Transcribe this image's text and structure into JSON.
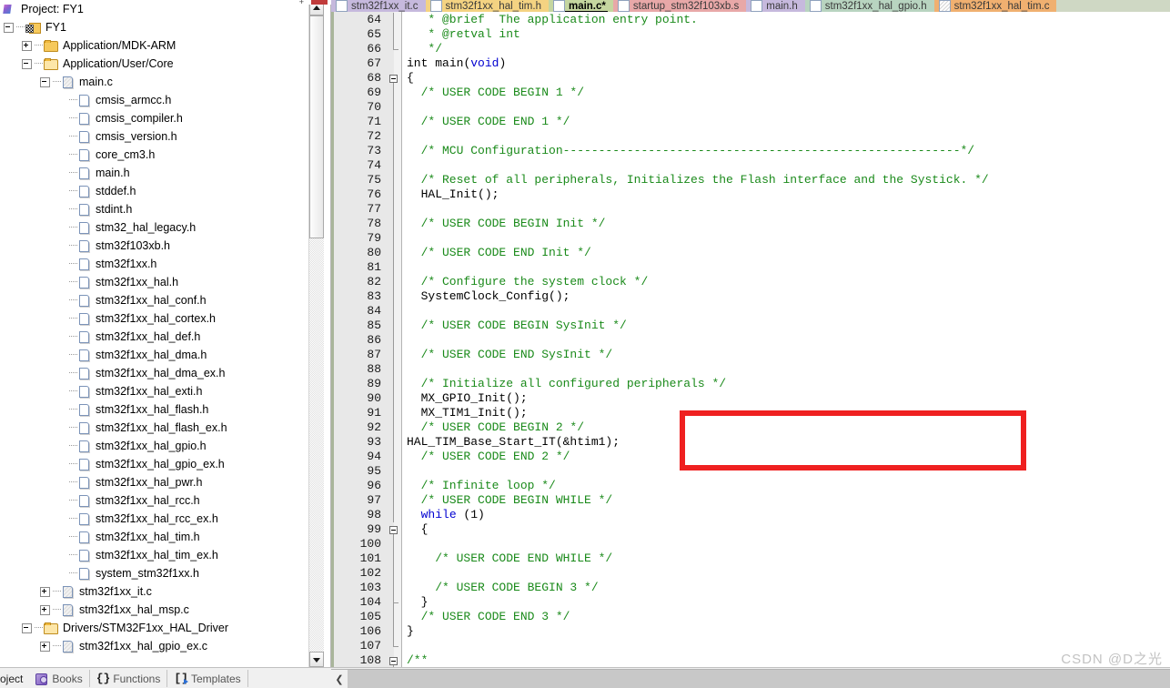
{
  "app": {
    "ide": "Keil uVision",
    "watermark": "CSDN @D之光"
  },
  "project_pane": {
    "header": "Project: FY1",
    "tree": [
      {
        "depth": 0,
        "label": "FY1",
        "icon": "target-icon",
        "expander": "minus"
      },
      {
        "depth": 1,
        "label": "Application/MDK-ARM",
        "icon": "folder-icon",
        "expander": "plus"
      },
      {
        "depth": 1,
        "label": "Application/User/Core",
        "icon": "folder-open-icon",
        "expander": "minus"
      },
      {
        "depth": 2,
        "label": "main.c",
        "icon": "source-file-icon",
        "expander": "minus"
      },
      {
        "depth": 3,
        "label": "cmsis_armcc.h",
        "icon": "header-file-icon",
        "expander": "none"
      },
      {
        "depth": 3,
        "label": "cmsis_compiler.h",
        "icon": "header-file-icon",
        "expander": "none"
      },
      {
        "depth": 3,
        "label": "cmsis_version.h",
        "icon": "header-file-icon",
        "expander": "none"
      },
      {
        "depth": 3,
        "label": "core_cm3.h",
        "icon": "header-file-icon",
        "expander": "none"
      },
      {
        "depth": 3,
        "label": "main.h",
        "icon": "header-file-icon",
        "expander": "none"
      },
      {
        "depth": 3,
        "label": "stddef.h",
        "icon": "header-file-icon",
        "expander": "none"
      },
      {
        "depth": 3,
        "label": "stdint.h",
        "icon": "header-file-icon",
        "expander": "none"
      },
      {
        "depth": 3,
        "label": "stm32_hal_legacy.h",
        "icon": "header-file-icon",
        "expander": "none"
      },
      {
        "depth": 3,
        "label": "stm32f103xb.h",
        "icon": "header-file-icon",
        "expander": "none"
      },
      {
        "depth": 3,
        "label": "stm32f1xx.h",
        "icon": "header-file-icon",
        "expander": "none"
      },
      {
        "depth": 3,
        "label": "stm32f1xx_hal.h",
        "icon": "header-file-icon",
        "expander": "none"
      },
      {
        "depth": 3,
        "label": "stm32f1xx_hal_conf.h",
        "icon": "header-file-icon",
        "expander": "none"
      },
      {
        "depth": 3,
        "label": "stm32f1xx_hal_cortex.h",
        "icon": "header-file-icon",
        "expander": "none"
      },
      {
        "depth": 3,
        "label": "stm32f1xx_hal_def.h",
        "icon": "header-file-icon",
        "expander": "none"
      },
      {
        "depth": 3,
        "label": "stm32f1xx_hal_dma.h",
        "icon": "header-file-icon",
        "expander": "none"
      },
      {
        "depth": 3,
        "label": "stm32f1xx_hal_dma_ex.h",
        "icon": "header-file-icon",
        "expander": "none"
      },
      {
        "depth": 3,
        "label": "stm32f1xx_hal_exti.h",
        "icon": "header-file-icon",
        "expander": "none"
      },
      {
        "depth": 3,
        "label": "stm32f1xx_hal_flash.h",
        "icon": "header-file-icon",
        "expander": "none"
      },
      {
        "depth": 3,
        "label": "stm32f1xx_hal_flash_ex.h",
        "icon": "header-file-icon",
        "expander": "none"
      },
      {
        "depth": 3,
        "label": "stm32f1xx_hal_gpio.h",
        "icon": "header-file-icon",
        "expander": "none"
      },
      {
        "depth": 3,
        "label": "stm32f1xx_hal_gpio_ex.h",
        "icon": "header-file-icon",
        "expander": "none"
      },
      {
        "depth": 3,
        "label": "stm32f1xx_hal_pwr.h",
        "icon": "header-file-icon",
        "expander": "none"
      },
      {
        "depth": 3,
        "label": "stm32f1xx_hal_rcc.h",
        "icon": "header-file-icon",
        "expander": "none"
      },
      {
        "depth": 3,
        "label": "stm32f1xx_hal_rcc_ex.h",
        "icon": "header-file-icon",
        "expander": "none"
      },
      {
        "depth": 3,
        "label": "stm32f1xx_hal_tim.h",
        "icon": "header-file-icon",
        "expander": "none"
      },
      {
        "depth": 3,
        "label": "stm32f1xx_hal_tim_ex.h",
        "icon": "header-file-icon",
        "expander": "none"
      },
      {
        "depth": 3,
        "label": "system_stm32f1xx.h",
        "icon": "header-file-icon",
        "expander": "none"
      },
      {
        "depth": 2,
        "label": "stm32f1xx_it.c",
        "icon": "source-file-icon",
        "expander": "plus"
      },
      {
        "depth": 2,
        "label": "stm32f1xx_hal_msp.c",
        "icon": "source-file-icon",
        "expander": "plus"
      },
      {
        "depth": 1,
        "label": "Drivers/STM32F1xx_HAL_Driver",
        "icon": "folder-open-icon",
        "expander": "minus"
      },
      {
        "depth": 2,
        "label": "stm32f1xx_hal_gpio_ex.c",
        "icon": "source-file-icon",
        "expander": "plus"
      }
    ]
  },
  "bottom_tabs": [
    {
      "label": "oject",
      "icon": "none",
      "clipped": true
    },
    {
      "label": "Books",
      "icon": "books-icon",
      "clipped": false
    },
    {
      "label": "Functions",
      "icon": "braces-icon",
      "clipped": false
    },
    {
      "label": "Templates",
      "icon": "templates-icon",
      "clipped": false
    }
  ],
  "doc_tabs": [
    {
      "label": "stm32f1xx_it.c",
      "color": "#c6b9dd",
      "active": false,
      "icon_hatched": false
    },
    {
      "label": "stm32f1xx_hal_tim.h",
      "color": "#f4d382",
      "active": false,
      "icon_hatched": false
    },
    {
      "label": "main.c",
      "color": "#c5d6a0",
      "active": true,
      "icon_hatched": false
    },
    {
      "label": "startup_stm32f103xb.s",
      "color": "#e8a8a8",
      "active": false,
      "icon_hatched": false
    },
    {
      "label": "main.h",
      "color": "#c6b9dd",
      "active": false,
      "icon_hatched": false
    },
    {
      "label": "stm32f1xx_hal_gpio.h",
      "color": "#b8d4c0",
      "active": false,
      "icon_hatched": false
    },
    {
      "label": "stm32f1xx_hal_tim.c",
      "color": "#f0b070",
      "active": false,
      "icon_hatched": true
    }
  ],
  "editor": {
    "file": "main.c",
    "first_line": 64,
    "lines": [
      {
        "n": 64,
        "fold": "bar",
        "tokens": [
          {
            "t": "   * @brief  The application entry point.",
            "c": "cm"
          }
        ]
      },
      {
        "n": 65,
        "fold": "bar",
        "tokens": [
          {
            "t": "   * @retval int",
            "c": "cm"
          }
        ]
      },
      {
        "n": 66,
        "fold": "end",
        "tokens": [
          {
            "t": "   */",
            "c": "cm"
          }
        ]
      },
      {
        "n": 67,
        "fold": "none",
        "tokens": [
          {
            "t": "int ",
            "c": "pl"
          },
          {
            "t": "main",
            "c": "pl"
          },
          {
            "t": "(",
            "c": "pl"
          },
          {
            "t": "void",
            "c": "kw"
          },
          {
            "t": ")",
            "c": "pl"
          }
        ]
      },
      {
        "n": 68,
        "fold": "box",
        "tokens": [
          {
            "t": "{",
            "c": "pl"
          }
        ]
      },
      {
        "n": 69,
        "fold": "bar",
        "tokens": [
          {
            "t": "  /* USER CODE BEGIN 1 */",
            "c": "cm"
          }
        ]
      },
      {
        "n": 70,
        "fold": "bar",
        "tokens": [
          {
            "t": "",
            "c": "pl"
          }
        ]
      },
      {
        "n": 71,
        "fold": "bar",
        "tokens": [
          {
            "t": "  /* USER CODE END 1 */",
            "c": "cm"
          }
        ]
      },
      {
        "n": 72,
        "fold": "bar",
        "tokens": [
          {
            "t": "",
            "c": "pl"
          }
        ]
      },
      {
        "n": 73,
        "fold": "bar",
        "tokens": [
          {
            "t": "  /* MCU Configuration--------------------------------------------------------*/",
            "c": "cm"
          }
        ]
      },
      {
        "n": 74,
        "fold": "bar",
        "tokens": [
          {
            "t": "",
            "c": "pl"
          }
        ]
      },
      {
        "n": 75,
        "fold": "bar",
        "tokens": [
          {
            "t": "  /* Reset of all peripherals, Initializes the Flash interface and the Systick. */",
            "c": "cm"
          }
        ]
      },
      {
        "n": 76,
        "fold": "bar",
        "tokens": [
          {
            "t": "  HAL_Init();",
            "c": "pl"
          }
        ]
      },
      {
        "n": 77,
        "fold": "bar",
        "tokens": [
          {
            "t": "",
            "c": "pl"
          }
        ]
      },
      {
        "n": 78,
        "fold": "bar",
        "tokens": [
          {
            "t": "  /* USER CODE BEGIN Init */",
            "c": "cm"
          }
        ]
      },
      {
        "n": 79,
        "fold": "bar",
        "tokens": [
          {
            "t": "",
            "c": "pl"
          }
        ]
      },
      {
        "n": 80,
        "fold": "bar",
        "tokens": [
          {
            "t": "  /* USER CODE END Init */",
            "c": "cm"
          }
        ]
      },
      {
        "n": 81,
        "fold": "bar",
        "tokens": [
          {
            "t": "",
            "c": "pl"
          }
        ]
      },
      {
        "n": 82,
        "fold": "bar",
        "tokens": [
          {
            "t": "  /* Configure the system clock */",
            "c": "cm"
          }
        ]
      },
      {
        "n": 83,
        "fold": "bar",
        "tokens": [
          {
            "t": "  SystemClock_Config();",
            "c": "pl"
          }
        ]
      },
      {
        "n": 84,
        "fold": "bar",
        "tokens": [
          {
            "t": "",
            "c": "pl"
          }
        ]
      },
      {
        "n": 85,
        "fold": "bar",
        "tokens": [
          {
            "t": "  /* USER CODE BEGIN SysInit */",
            "c": "cm"
          }
        ]
      },
      {
        "n": 86,
        "fold": "bar",
        "tokens": [
          {
            "t": "",
            "c": "pl"
          }
        ]
      },
      {
        "n": 87,
        "fold": "bar",
        "tokens": [
          {
            "t": "  /* USER CODE END SysInit */",
            "c": "cm"
          }
        ]
      },
      {
        "n": 88,
        "fold": "bar",
        "tokens": [
          {
            "t": "",
            "c": "pl"
          }
        ]
      },
      {
        "n": 89,
        "fold": "bar",
        "tokens": [
          {
            "t": "  /* Initialize all configured peripherals */",
            "c": "cm"
          }
        ]
      },
      {
        "n": 90,
        "fold": "bar",
        "tokens": [
          {
            "t": "  MX_GPIO_Init();",
            "c": "pl"
          }
        ]
      },
      {
        "n": 91,
        "fold": "bar",
        "tokens": [
          {
            "t": "  MX_TIM1_Init();",
            "c": "pl"
          }
        ]
      },
      {
        "n": 92,
        "fold": "bar",
        "tokens": [
          {
            "t": "  /* USER CODE BEGIN 2 */",
            "c": "cm"
          }
        ]
      },
      {
        "n": 93,
        "fold": "bar",
        "tokens": [
          {
            "t": "HAL_TIM_Base_Start_IT(&htim1);",
            "c": "pl"
          }
        ]
      },
      {
        "n": 94,
        "fold": "bar",
        "tokens": [
          {
            "t": "  /* USER CODE END 2 */",
            "c": "cm"
          }
        ]
      },
      {
        "n": 95,
        "fold": "bar",
        "tokens": [
          {
            "t": "",
            "c": "pl"
          }
        ]
      },
      {
        "n": 96,
        "fold": "bar",
        "tokens": [
          {
            "t": "  /* Infinite loop */",
            "c": "cm"
          }
        ]
      },
      {
        "n": 97,
        "fold": "bar",
        "tokens": [
          {
            "t": "  /* USER CODE BEGIN WHILE */",
            "c": "cm"
          }
        ]
      },
      {
        "n": 98,
        "fold": "bar",
        "tokens": [
          {
            "t": "  ",
            "c": "pl"
          },
          {
            "t": "while",
            "c": "kw"
          },
          {
            "t": " (1)",
            "c": "pl"
          }
        ]
      },
      {
        "n": 99,
        "fold": "box",
        "tokens": [
          {
            "t": "  {",
            "c": "pl"
          }
        ]
      },
      {
        "n": 100,
        "fold": "bar",
        "tokens": [
          {
            "t": "",
            "c": "pl"
          }
        ]
      },
      {
        "n": 101,
        "fold": "bar",
        "tokens": [
          {
            "t": "    /* USER CODE END WHILE */",
            "c": "cm"
          }
        ]
      },
      {
        "n": 102,
        "fold": "bar",
        "tokens": [
          {
            "t": "",
            "c": "pl"
          }
        ]
      },
      {
        "n": 103,
        "fold": "bar",
        "tokens": [
          {
            "t": "    /* USER CODE BEGIN 3 */",
            "c": "cm"
          }
        ]
      },
      {
        "n": 104,
        "fold": "endinner",
        "tokens": [
          {
            "t": "  }",
            "c": "pl"
          }
        ]
      },
      {
        "n": 105,
        "fold": "bar",
        "tokens": [
          {
            "t": "  /* USER CODE END 3 */",
            "c": "cm"
          }
        ]
      },
      {
        "n": 106,
        "fold": "bar",
        "tokens": [
          {
            "t": "}",
            "c": "pl"
          }
        ]
      },
      {
        "n": 107,
        "fold": "end",
        "tokens": [
          {
            "t": "",
            "c": "pl"
          }
        ]
      },
      {
        "n": 108,
        "fold": "box",
        "tokens": [
          {
            "t": "/**",
            "c": "cm"
          }
        ]
      }
    ],
    "highlight": {
      "label": "red-annotation-box",
      "color": "#ef2020",
      "from_line": 92,
      "to_line": 94
    }
  },
  "colors": {
    "comment_green": "#1a8a1a",
    "keyword_blue": "#0000d0",
    "gutter_gray": "#e8e8e8",
    "tabbar_bg": "#cfd8c4",
    "annotation_red": "#ef2020"
  },
  "scrollbars": {
    "project_vertical": "project-vertical-scrollbar",
    "editor_horizontal": "editor-horizontal-scrollbar"
  }
}
